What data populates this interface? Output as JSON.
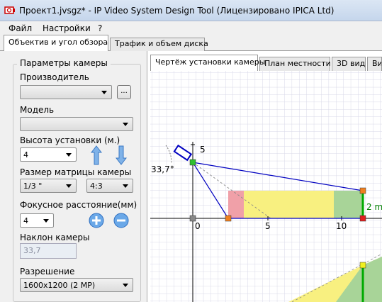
{
  "window": {
    "title": "Проект1.jvsgz* - IP Video System Design Tool (Лицензировано  IPICA Ltd)"
  },
  "menu": {
    "items": [
      "Файл",
      "Настройки",
      "?"
    ]
  },
  "main_tabs": [
    "Объектив и угол обзора",
    "Трафик и объем диска"
  ],
  "camera": {
    "group_title": "Параметры камеры",
    "manufacturer_label": "Производитель",
    "manufacturer_value": "",
    "browse_label": "...",
    "model_label": "Модель",
    "model_value": "",
    "height_label": "Высота установки (м.)",
    "height_value": "4",
    "sensor_label": "Размер матрицы камеры",
    "sensor_value": "1/3 \"",
    "aspect_value": "4:3",
    "focal_label": "Фокусное расстояние(мм)",
    "focal_value": "4",
    "tilt_label": "Наклон камеры",
    "tilt_value": "33,7",
    "resolution_label": "Разрешение",
    "resolution_value": "1600x1200 (2 MP)"
  },
  "view_tabs": [
    "Чертёж установки камеры",
    "План местности",
    "3D вид",
    "Вид"
  ],
  "drawing": {
    "angle_label": "33,7°",
    "y_tick": "5",
    "x_ticks": [
      "0",
      "5",
      "10"
    ],
    "distance_label": "2 m"
  },
  "colors": {
    "grid": "#d9d9e8",
    "axis": "#000000",
    "beam": "#0000c0",
    "pink_zone": "#f0a0a8",
    "yellow_zone": "#f8f080",
    "green_zone": "#a8d498",
    "green_line": "#00aa00",
    "distance_text": "#008000"
  }
}
